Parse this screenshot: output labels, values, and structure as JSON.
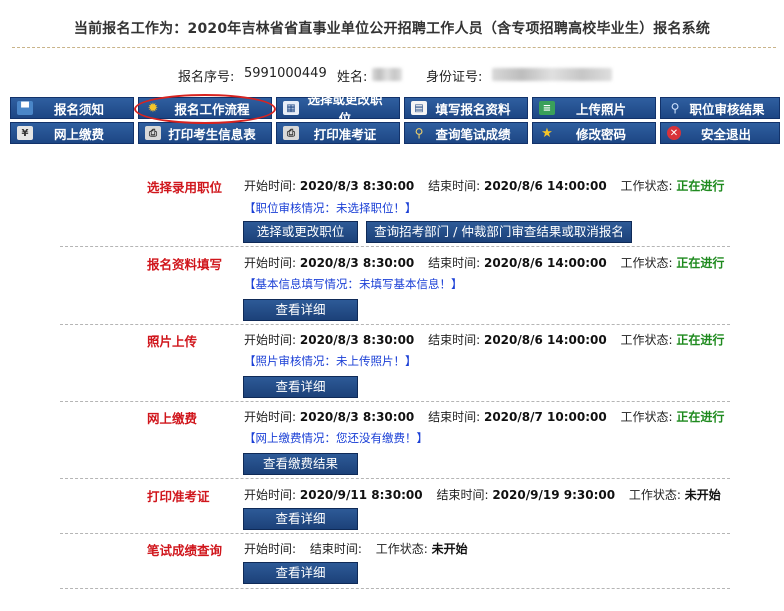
{
  "header": {
    "title": "当前报名工作为：2020年吉林省省直事业单位公开招聘工作人员（含专项招聘高校毕业生）报名系统"
  },
  "applicant": {
    "serial_label": "报名序号:",
    "serial_value": "5991000449",
    "name_label": "姓名:",
    "id_label": "身份证号:"
  },
  "nav": {
    "items": [
      {
        "label": "报名须知",
        "icon": "chat-icon"
      },
      {
        "label": "报名工作流程",
        "icon": "sun-icon"
      },
      {
        "label": "选择或更改职位",
        "icon": "window-icon"
      },
      {
        "label": "填写报名资料",
        "icon": "form-icon"
      },
      {
        "label": "上传照片",
        "icon": "stack-icon"
      },
      {
        "label": "职位审核结果",
        "icon": "magnifier-icon"
      },
      {
        "label": "网上缴费",
        "icon": "yen-icon"
      },
      {
        "label": "打印考生信息表",
        "icon": "printer-icon"
      },
      {
        "label": "打印准考证",
        "icon": "printer-icon"
      },
      {
        "label": "查询笔试成绩",
        "icon": "magnifier-icon"
      },
      {
        "label": "修改密码",
        "icon": "star-icon"
      },
      {
        "label": "安全退出",
        "icon": "exit-icon"
      }
    ]
  },
  "labels": {
    "start": "开始时间:",
    "end": "结束时间:",
    "status": "工作状态:"
  },
  "steps": [
    {
      "name": "选择录用职位",
      "start": "2020/8/3 8:30:00",
      "end": "2020/8/6 14:00:00",
      "status": "正在进行",
      "notice": "【职位审核情况：未选择职位！】",
      "buttons": [
        "选择或更改职位",
        "查询招考部门 / 仲裁部门审查结果或取消报名"
      ]
    },
    {
      "name": "报名资料填写",
      "start": "2020/8/3 8:30:00",
      "end": "2020/8/6 14:00:00",
      "status": "正在进行",
      "notice": "【基本信息填写情况：未填写基本信息！】",
      "buttons": [
        "查看详细"
      ]
    },
    {
      "name": "照片上传",
      "start": "2020/8/3 8:30:00",
      "end": "2020/8/6 14:00:00",
      "status": "正在进行",
      "notice": "【照片审核情况：未上传照片！】",
      "buttons": [
        "查看详细"
      ]
    },
    {
      "name": "网上缴费",
      "start": "2020/8/3 8:30:00",
      "end": "2020/8/7 10:00:00",
      "status": "正在进行",
      "notice": "【网上缴费情况：您还没有缴费！】",
      "buttons": [
        "查看缴费结果"
      ]
    },
    {
      "name": "打印准考证",
      "start": "2020/9/11 8:30:00",
      "end": "2020/9/19 9:30:00",
      "status": "未开始",
      "notice": "",
      "buttons": [
        "查看详细"
      ]
    },
    {
      "name": "笔试成绩查询",
      "start": "",
      "end": "",
      "status": "未开始",
      "notice": "",
      "buttons": [
        "查看详细"
      ]
    }
  ],
  "colors": {
    "nav_bg": "#1d4684",
    "step_name": "#d0161c",
    "status_running": "#1e8a1e",
    "notice": "#1a3fd6",
    "highlight": "#d8231f"
  }
}
